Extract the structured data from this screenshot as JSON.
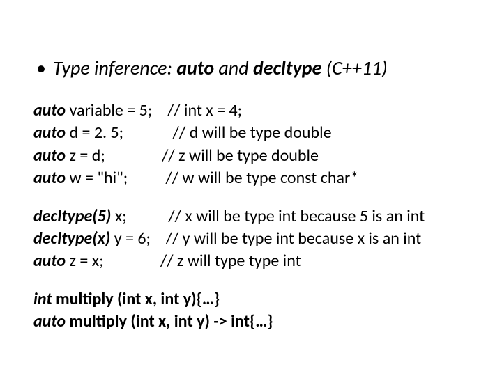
{
  "heading": {
    "pre": "Type inference: ",
    "kw1": "auto",
    "mid": "  and ",
    "kw2": "decltype",
    "post": " (C++11)"
  },
  "block1": {
    "l1a": "auto",
    "l1b": " variable = 5;    // int x = 4;",
    "l2a": "auto",
    "l2b": " d = 2. 5;             // d will be type double",
    "l3a": "auto",
    "l3b": " z = d;               // z will be type double",
    "l4a": "auto",
    "l4b": " w = \"hi\";          // w will be type const char*"
  },
  "block2": {
    "l1a": "decltype(5)",
    "l1b": " x;           // x will be type int because 5 is an int",
    "l2a": "decltype(x)",
    "l2b": " y = 6;    // y will be type int because x is an int",
    "l3a": "auto",
    "l3b": " z = x;               // z will type type int"
  },
  "block3": {
    "l1a": "int",
    "l1b": " multiply (int x, int y){…}",
    "l2a": "auto",
    "l2b": " multiply (int x, int y) -> int{…}"
  }
}
